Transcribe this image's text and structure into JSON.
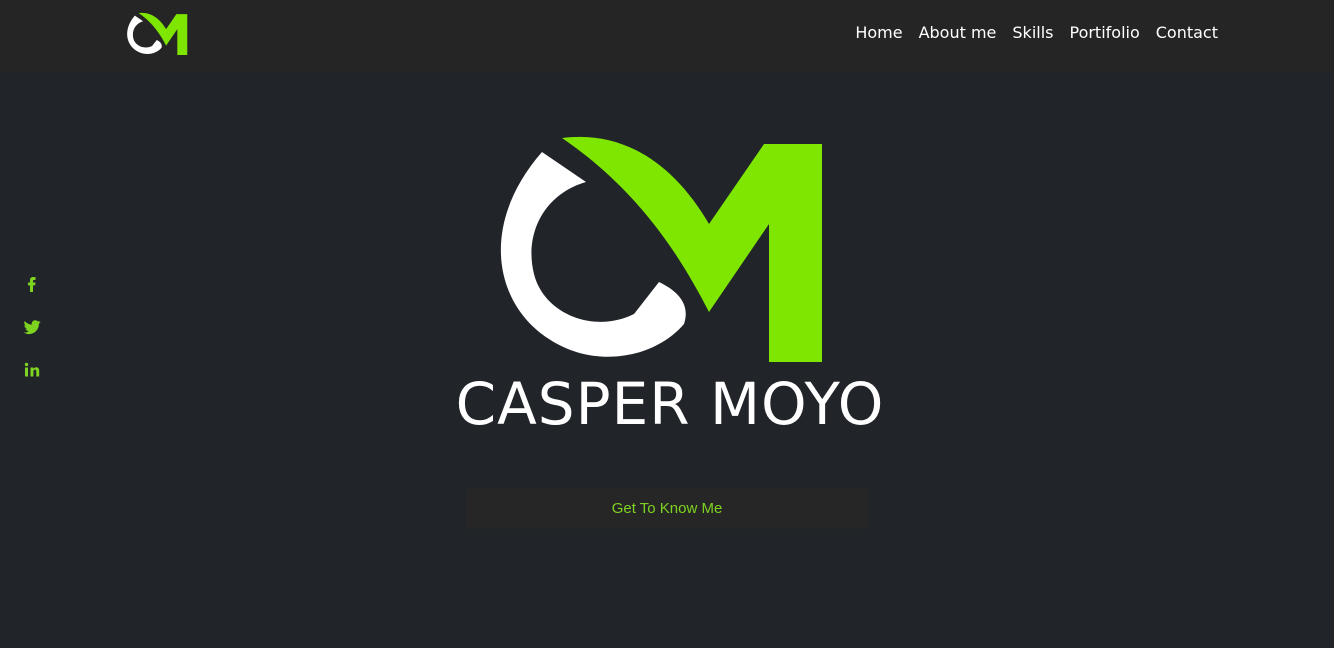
{
  "colors": {
    "background": "#212429",
    "navbar": "#252525",
    "accent": "#7ee600",
    "text": "#ffffff",
    "button_bg": "#262626",
    "button_text": "#7ed321"
  },
  "nav": {
    "logo": "CM logo",
    "links": [
      {
        "label": "Home"
      },
      {
        "label": "About me"
      },
      {
        "label": "Skills"
      },
      {
        "label": "Portifolio"
      },
      {
        "label": "Contact"
      }
    ]
  },
  "social": [
    {
      "icon": "facebook-icon"
    },
    {
      "icon": "twitter-icon"
    },
    {
      "icon": "linkedin-icon"
    }
  ],
  "hero": {
    "logo": "CM logo",
    "name": "CASPER MOYO",
    "cta_label": "Get To Know Me"
  }
}
